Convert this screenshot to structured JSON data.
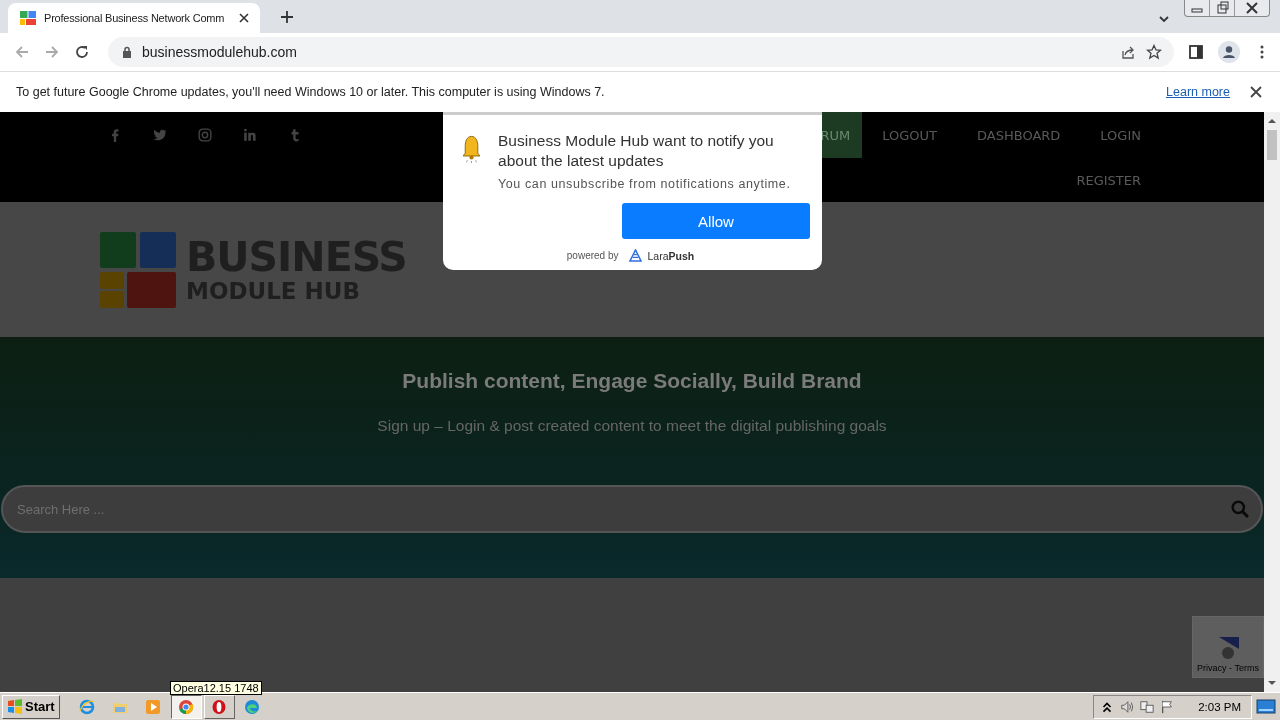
{
  "browser": {
    "tab": {
      "title": "Professional Business Network Comm",
      "selected": true
    },
    "address": "businessmodulehub.com"
  },
  "infobar": {
    "message": "To get future Google Chrome updates, you'll need Windows 10 or later. This computer is using Windows 7.",
    "link": "Learn more"
  },
  "site": {
    "nav": [
      {
        "label": "RUM",
        "selected": true
      },
      {
        "label": "LOGOUT",
        "selected": false
      },
      {
        "label": "DASHBOARD",
        "selected": false
      },
      {
        "label": "LOGIN",
        "selected": false
      }
    ],
    "nav_row2": [
      {
        "label": "REGISTER",
        "selected": false
      }
    ],
    "logo": {
      "line1": "BUSINESS",
      "line2": "MODULE HUB"
    },
    "hero": {
      "title": "Publish content, Engage Socially, Build Brand",
      "subtitle": "Sign up – Login & post created content to meet the digital publishing goals"
    },
    "search": {
      "placeholder": "Search Here ..."
    },
    "recaptcha": "Privacy - Terms"
  },
  "popup": {
    "title": "Business Module Hub want to notify you about the latest updates",
    "subtitle": "You can unsubscribe from notifications anytime.",
    "button": "Allow",
    "powered_by": "powered by",
    "brand": "Lara**Push**"
  },
  "taskbar": {
    "start": "Start",
    "apps": [
      {
        "kind": "ie",
        "selected": false
      },
      {
        "kind": "folder",
        "selected": false
      },
      {
        "kind": "media",
        "selected": false
      },
      {
        "kind": "chrome",
        "selected": true
      },
      {
        "kind": "opera",
        "selected": false
      },
      {
        "kind": "edge",
        "selected": false
      }
    ],
    "tooltip": "Opera12.15 1748",
    "clock": "2:03 PM"
  }
}
